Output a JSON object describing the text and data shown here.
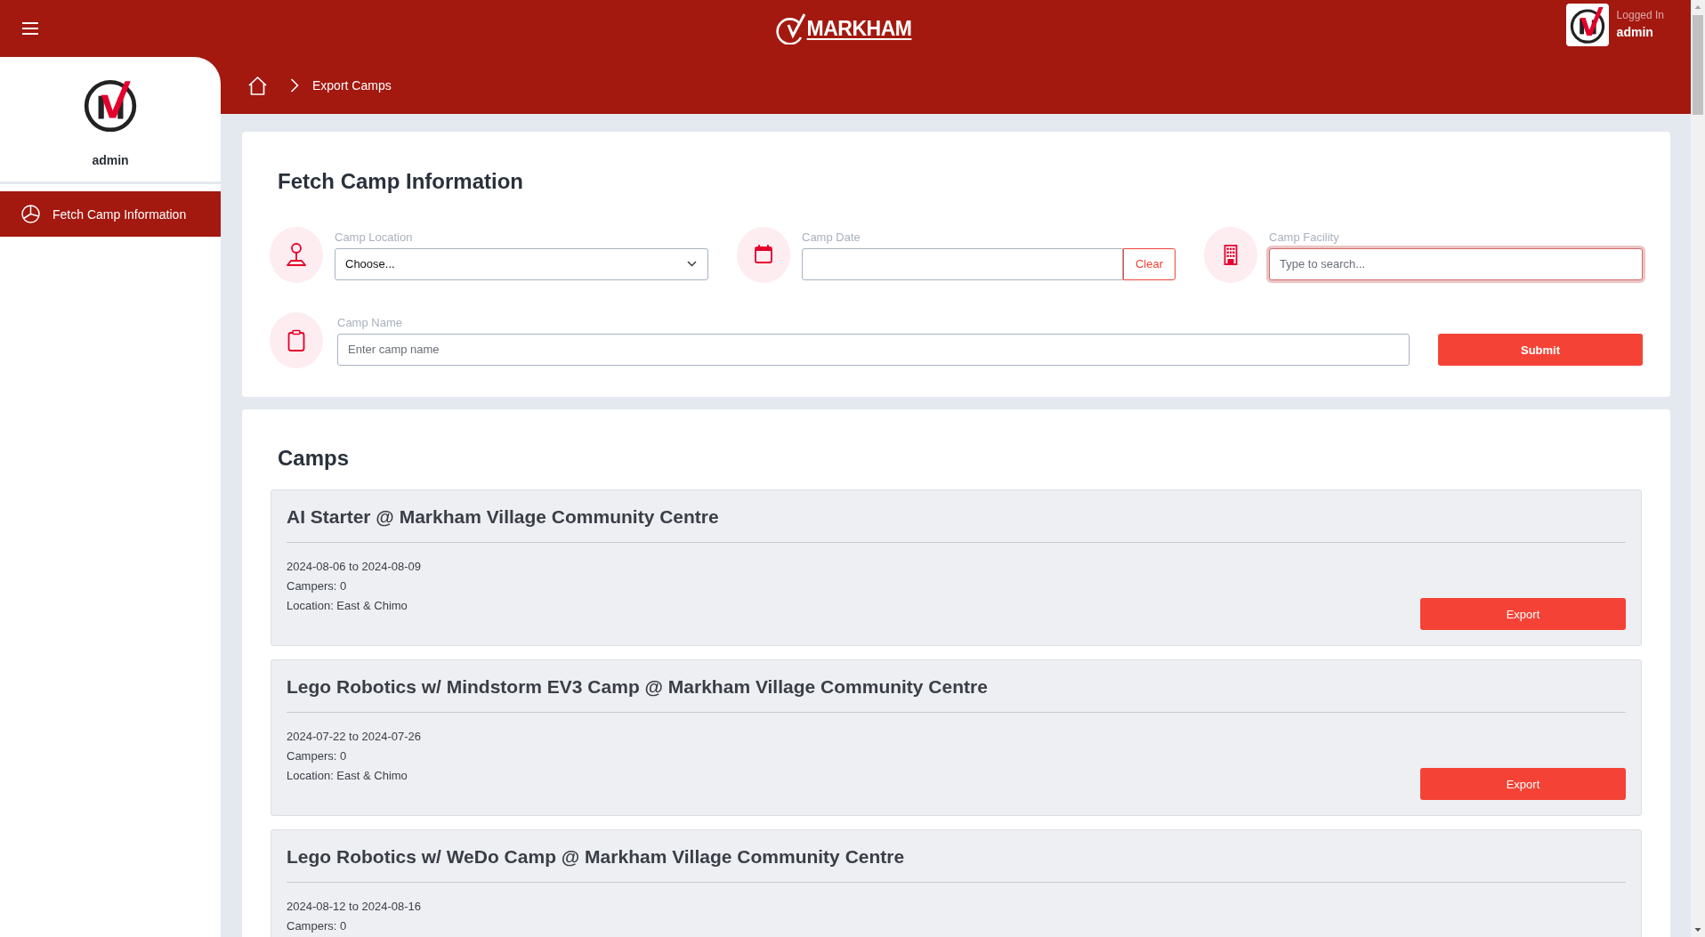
{
  "header": {
    "brand": "MARKHAM",
    "user": {
      "status": "Logged In",
      "name": "admin"
    }
  },
  "sidebar": {
    "user_name": "admin",
    "items": [
      {
        "label": "Fetch Camp Information",
        "selected": true
      }
    ]
  },
  "breadcrumb": {
    "items": [
      "Export Camps"
    ]
  },
  "search_form": {
    "title": "Fetch Camp Information",
    "fields": [
      {
        "kind": "select",
        "label": "Camp Location",
        "value": "Choose..."
      },
      {
        "kind": "date",
        "label": "Camp Date",
        "clear_button": "Clear"
      },
      {
        "kind": "search",
        "label": "Camp Facility",
        "placeholder": "Type to search...",
        "focused": true
      },
      {
        "kind": "text",
        "label": "Camp Name",
        "placeholder": "Enter camp name"
      }
    ],
    "submit_button": "Submit"
  },
  "camps": {
    "title": "Camps",
    "items": [
      {
        "name": "AI Starter @ Markham Village Community Centre",
        "dates": "2024-08-06 to 2024-08-09",
        "campers": "Campers: 0",
        "location": "Location: East & Chimo",
        "export_button": "Export"
      },
      {
        "name": "Lego Robotics w/ Mindstorm EV3 Camp @ Markham Village Community Centre",
        "dates": "2024-07-22 to 2024-07-26",
        "campers": "Campers: 0",
        "location": "Location: East & Chimo",
        "export_button": "Export"
      },
      {
        "name": "Lego Robotics w/ WeDo Camp @ Markham Village Community Centre",
        "dates": "2024-08-12 to 2024-08-16",
        "campers": "Campers: 0"
      }
    ]
  }
}
